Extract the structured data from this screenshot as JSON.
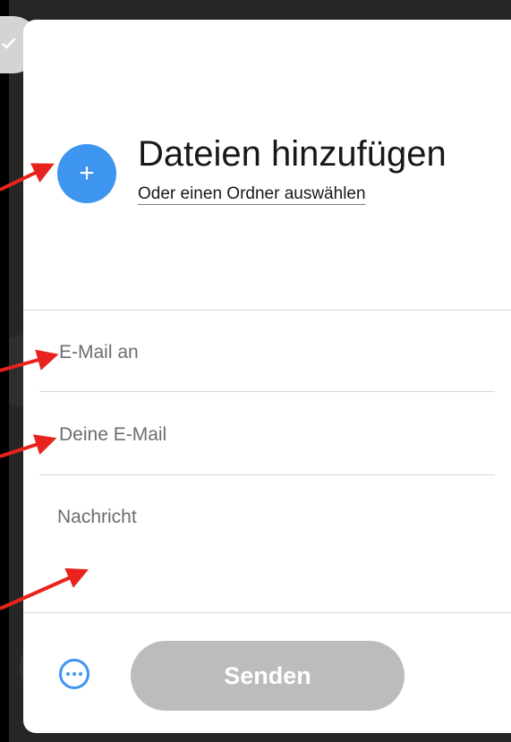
{
  "upload": {
    "add_icon": "+",
    "title": "Dateien hinzufügen",
    "folder_link": "Oder einen Ordner auswählen"
  },
  "form": {
    "email_to_placeholder": "E-Mail an",
    "your_email_placeholder": "Deine E-Mail",
    "message_placeholder": "Nachricht"
  },
  "footer": {
    "more_icon": "more-options-icon",
    "send_label": "Senden"
  },
  "colors": {
    "accent": "#3d95f0",
    "send_disabled": "#bbbcbe",
    "annotation_arrow": "#e8231d"
  }
}
